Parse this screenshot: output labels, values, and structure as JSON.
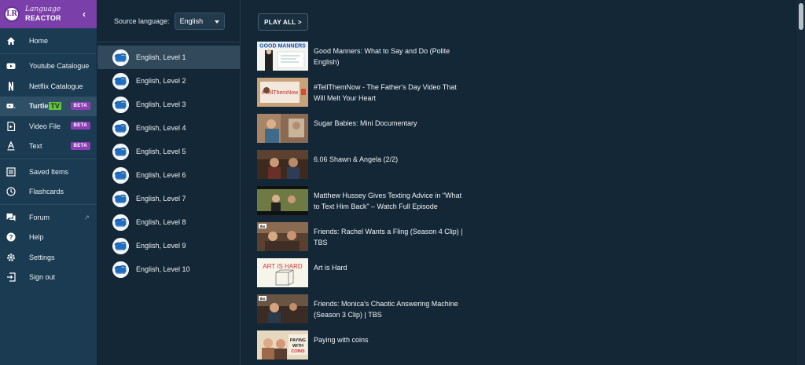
{
  "brand": {
    "line1": "Language",
    "line2": "REACTOR",
    "logo_text": "LR"
  },
  "nav": {
    "group1": [
      {
        "label": "Home",
        "icon": "home-icon"
      }
    ],
    "group2": [
      {
        "label": "Youtube Catalogue",
        "icon": "youtube-icon"
      },
      {
        "label": "Netflix Catalogue",
        "icon": "netflix-icon"
      },
      {
        "label": "Turtle",
        "tv": "TV",
        "beta": "BETA",
        "icon": "turtle-tv-icon"
      },
      {
        "label": "Video File",
        "beta": "BETA",
        "icon": "video-file-icon"
      },
      {
        "label": "Text",
        "beta": "BETA",
        "icon": "text-icon"
      }
    ],
    "group3": [
      {
        "label": "Saved Items",
        "icon": "saved-items-icon"
      },
      {
        "label": "Flashcards",
        "icon": "flashcards-icon"
      }
    ],
    "group4": [
      {
        "label": "Forum",
        "icon": "forum-icon"
      },
      {
        "label": "Help",
        "icon": "help-icon"
      },
      {
        "label": "Settings",
        "icon": "settings-icon"
      },
      {
        "label": "Sign out",
        "icon": "sign-out-icon"
      }
    ]
  },
  "source_language": {
    "label": "Source language:",
    "value": "English"
  },
  "levels": [
    "English, Level 1",
    "English, Level 2",
    "English, Level 3",
    "English, Level 4",
    "English, Level 5",
    "English, Level 6",
    "English, Level 7",
    "English, Level 8",
    "English, Level 9",
    "English, Level 10"
  ],
  "play_all": "PLAY ALL >",
  "videos": [
    {
      "title": "Good Manners: What to Say and Do (Polite English)",
      "thumb_text": "GOOD MANNERS"
    },
    {
      "title": "#TellThemNow - The Father's Day Video That Will Melt Your Heart",
      "thumb_text": "#TellThemNow"
    },
    {
      "title": "Sugar Babies: Mini Documentary"
    },
    {
      "title": "6.06 Shawn & Angela (2/2)"
    },
    {
      "title": "Matthew Hussey Gives Texting Advice in \"What to Text Him Back\" – Watch Full Episode"
    },
    {
      "title": "Friends: Rachel Wants a Fling (Season 4 Clip) | TBS",
      "thumb_text": "tbs"
    },
    {
      "title": "Art is Hard",
      "thumb_text": "ART IS HARD"
    },
    {
      "title": "Friends: Monica's Chaotic Answering Machine (Season 3 Clip) | TBS",
      "thumb_text": "tbs"
    },
    {
      "title": "Paying with coins",
      "thumb_text": "PAYING WITH COINS"
    }
  ]
}
